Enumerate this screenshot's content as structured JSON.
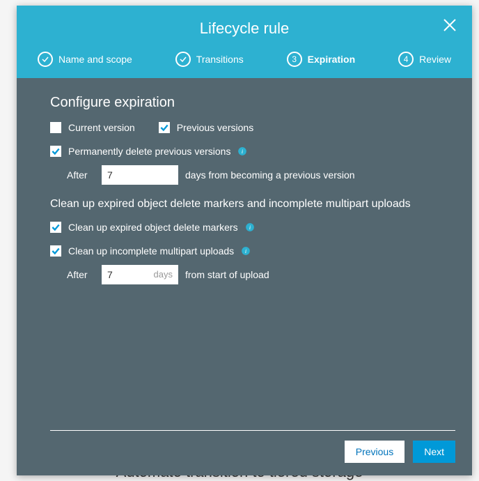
{
  "backdrop_text": "Automate transition to tiered storage",
  "modal": {
    "title": "Lifecycle rule",
    "steps": [
      {
        "label": "Name and scope",
        "state": "done"
      },
      {
        "label": "Transitions",
        "state": "done"
      },
      {
        "label": "Expiration",
        "state": "active",
        "number": "3"
      },
      {
        "label": "Review",
        "state": "pending",
        "number": "4"
      }
    ]
  },
  "body": {
    "section_title": "Configure expiration",
    "current_version_label": "Current version",
    "current_version_checked": false,
    "previous_versions_label": "Previous versions",
    "previous_versions_checked": true,
    "perm_delete_label": "Permanently delete previous versions",
    "perm_delete_checked": true,
    "after_label": "After",
    "perm_delete_days": "7",
    "perm_delete_suffix": "days from becoming a previous version",
    "cleanup_heading": "Clean up expired object delete markers and incomplete multipart uploads",
    "cleanup_markers_label": "Clean up expired object delete markers",
    "cleanup_markers_checked": true,
    "cleanup_multipart_label": "Clean up incomplete multipart uploads",
    "cleanup_multipart_checked": true,
    "multipart_days": "7",
    "multipart_unit": "days",
    "multipart_suffix": "from start of upload"
  },
  "footer": {
    "previous": "Previous",
    "next": "Next"
  }
}
